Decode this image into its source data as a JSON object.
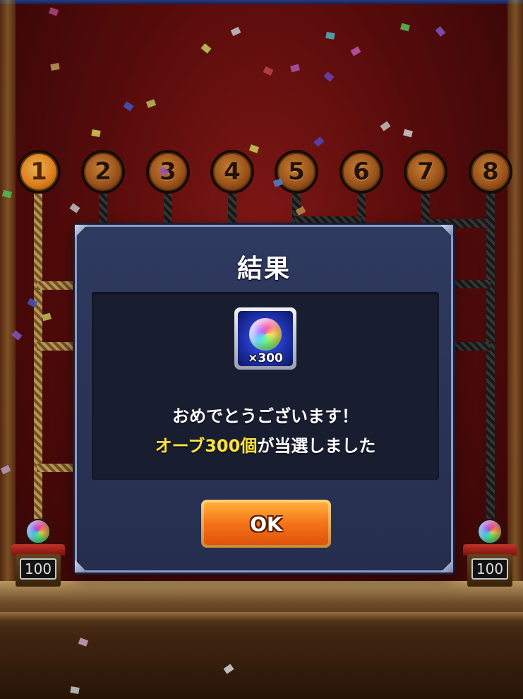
{
  "slots": [
    {
      "number": "1",
      "active": true
    },
    {
      "number": "2",
      "active": false
    },
    {
      "number": "3",
      "active": false
    },
    {
      "number": "4",
      "active": false
    },
    {
      "number": "5",
      "active": false
    },
    {
      "number": "6",
      "active": false
    },
    {
      "number": "7",
      "active": false
    },
    {
      "number": "8",
      "active": false
    }
  ],
  "pedestals": {
    "left_value": "100",
    "right_value": "100"
  },
  "dialog": {
    "title": "結果",
    "prize_count": "×300",
    "message_line1": "おめでとうございます！",
    "message_highlight": "オーブ300個",
    "message_rest": "が当選しました",
    "ok_label": "OK"
  },
  "icons": {
    "prize": "rainbow-orb-icon"
  },
  "colors": {
    "highlight": "#ffe23a",
    "button": "#f4731a",
    "modal": "#2f3a60"
  }
}
